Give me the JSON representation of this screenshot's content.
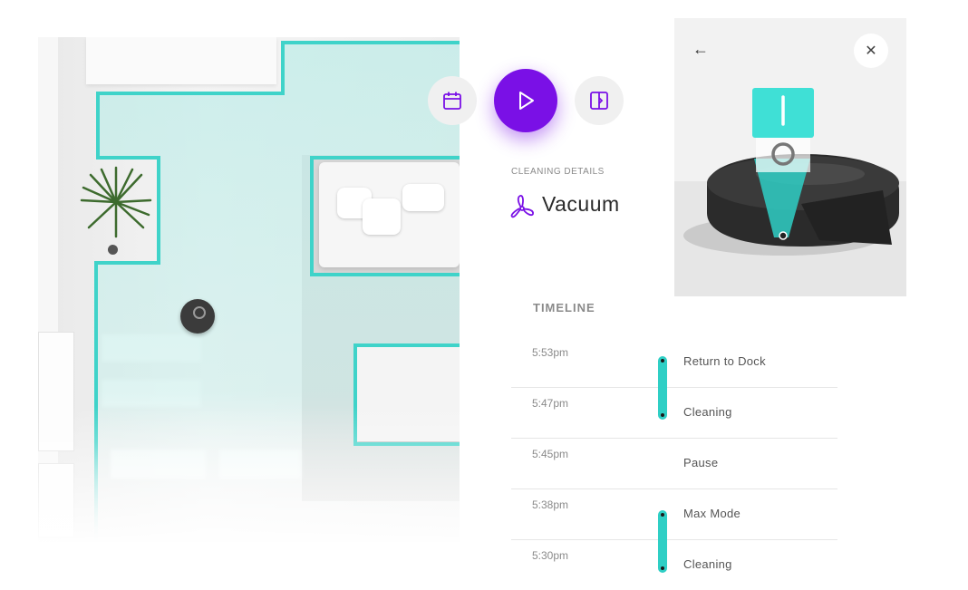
{
  "controls": {
    "schedule_icon": "calendar-icon",
    "play_icon": "play-icon",
    "map_icon": "map-icon"
  },
  "details": {
    "label": "CLEANING DETAILS",
    "mode": "Vacuum",
    "mode_icon": "fan-icon"
  },
  "card": {
    "back_icon": "←",
    "close_icon": "✕"
  },
  "timeline": {
    "title": "TIMELINE",
    "entries": [
      {
        "time": "5:53pm",
        "event": "Return to Dock"
      },
      {
        "time": "5:47pm",
        "event": "Cleaning"
      },
      {
        "time": "5:45pm",
        "event": "Pause"
      },
      {
        "time": "5:38pm",
        "event": "Max Mode"
      },
      {
        "time": "5:30pm",
        "event": "Cleaning"
      }
    ]
  },
  "colors": {
    "accent_purple": "#7a10e6",
    "accent_teal": "#2fcfc5"
  }
}
